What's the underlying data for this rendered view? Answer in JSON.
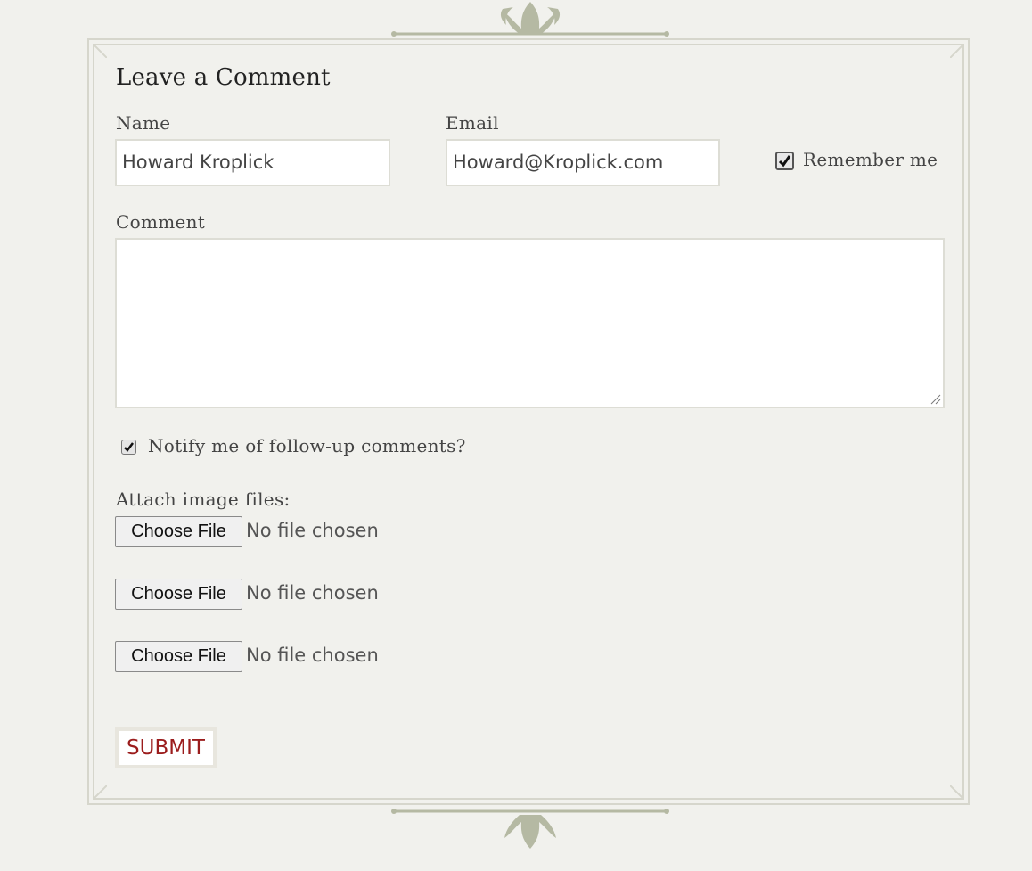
{
  "form": {
    "title": "Leave a Comment",
    "name_label": "Name",
    "name_value": "Howard Kroplick",
    "email_label": "Email",
    "email_value": "Howard@Kroplick.com",
    "remember_label": "Remember me",
    "remember_checked": true,
    "comment_label": "Comment",
    "comment_value": "",
    "notify_label": "Notify me of follow-up comments?",
    "notify_checked": true,
    "attach_label": "Attach image files:",
    "files": [
      {
        "button": "Choose File",
        "status": "No file chosen"
      },
      {
        "button": "Choose File",
        "status": "No file chosen"
      },
      {
        "button": "Choose File",
        "status": "No file chosen"
      }
    ],
    "submit_label": "SUBMIT"
  },
  "colors": {
    "background": "#f1f1ed",
    "frame": "#d6d6cc",
    "ornament": "#b5b9a3",
    "submit_text": "#9b1c1c"
  }
}
